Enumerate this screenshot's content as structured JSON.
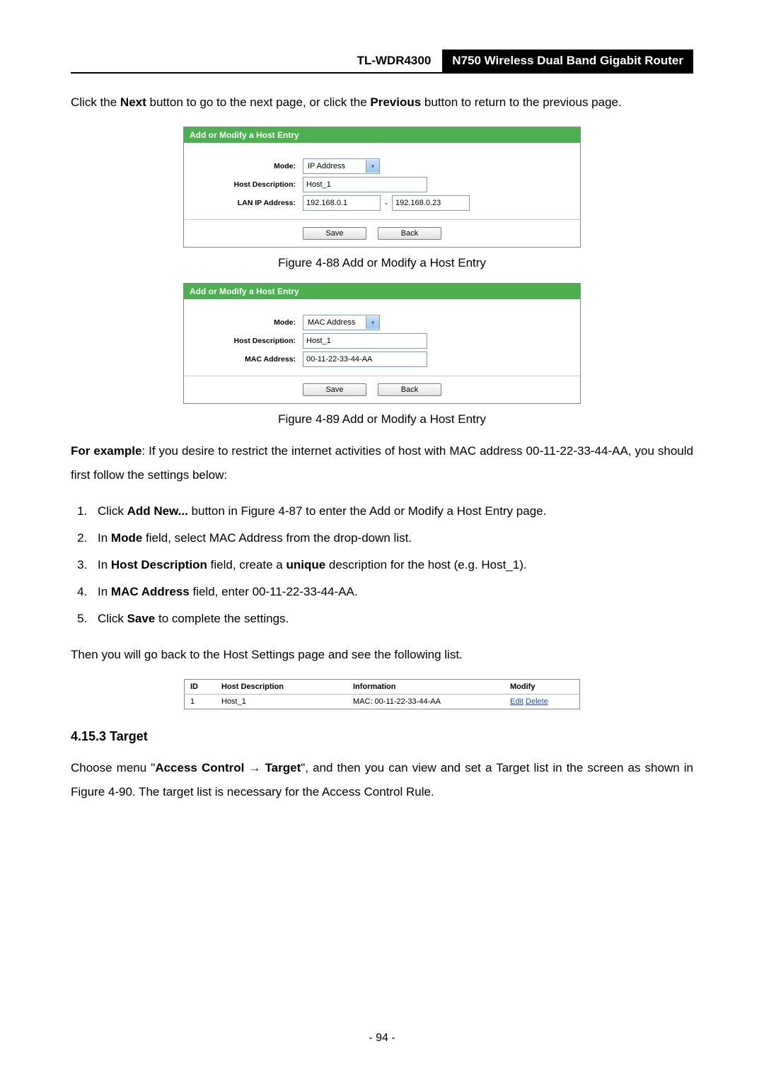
{
  "header": {
    "model": "TL-WDR4300",
    "title": "N750 Wireless Dual Band Gigabit Router"
  },
  "intro": {
    "pre_next": "Click the ",
    "next_bold": "Next",
    "mid": " button to go to the next page, or click the ",
    "prev_bold": "Previous",
    "post": " button to return to the previous page."
  },
  "figure1": {
    "title": "Add or Modify a Host Entry",
    "mode_label": "Mode:",
    "mode_value": "IP Address",
    "hostdesc_label": "Host Description:",
    "hostdesc_value": "Host_1",
    "ip_label": "LAN IP Address:",
    "ip_from": "192.168.0.1",
    "ip_dash": "-",
    "ip_to": "192.168.0.23",
    "save": "Save",
    "back": "Back",
    "caption": "Figure 4-88 Add or Modify a Host Entry"
  },
  "figure2": {
    "title": "Add or Modify a Host Entry",
    "mode_label": "Mode:",
    "mode_value": "MAC Address",
    "hostdesc_label": "Host Description:",
    "hostdesc_value": "Host_1",
    "mac_label": "MAC Address:",
    "mac_value": "00-11-22-33-44-AA",
    "save": "Save",
    "back": "Back",
    "caption": "Figure 4-89 Add or Modify a Host Entry"
  },
  "example": {
    "lead_bold": "For example",
    "lead_rest": ": If you desire to restrict the internet activities of host with MAC address 00-11-22-33-44-AA, you should first follow the settings below:"
  },
  "steps": [
    {
      "pre": "Click ",
      "b1": "Add New...",
      "post": " button in Figure 4-87 to enter the Add or Modify a Host Entry page."
    },
    {
      "pre": "In ",
      "b1": "Mode",
      "post": " field, select MAC Address from the drop-down list."
    },
    {
      "pre": "In ",
      "b1": "Host Description",
      "mid": " field, create a ",
      "b2": "unique",
      "post": " description for the host (e.g. Host_1)."
    },
    {
      "pre": "In ",
      "b1": "MAC Address",
      "post": " field, enter 00-11-22-33-44-AA."
    },
    {
      "pre": "Click ",
      "b1": "Save",
      "post": " to complete the settings."
    }
  ],
  "then_text": "Then you will go back to the Host Settings page and see the following list.",
  "table": {
    "headers": {
      "id": "ID",
      "hostdesc": "Host Description",
      "info": "Information",
      "modify": "Modify"
    },
    "row": {
      "id": "1",
      "hostdesc": "Host_1",
      "info": "MAC: 00-11-22-33-44-AA",
      "edit": "Edit",
      "delete": "Delete"
    }
  },
  "section": {
    "heading": "4.15.3  Target",
    "text_pre": "Choose menu \"",
    "b1": "Access Control",
    "arrow": " → ",
    "b2": "Target",
    "text_post": "\", and then you can view and set a Target list in the screen as shown in Figure 4-90. The target list is necessary for the Access Control Rule."
  },
  "pagenum": "- 94 -"
}
